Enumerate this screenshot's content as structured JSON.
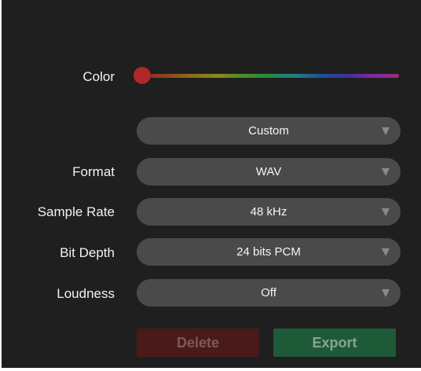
{
  "color": {
    "label": "Color",
    "value_fraction": 0.0
  },
  "preset": {
    "value": "Custom"
  },
  "format": {
    "label": "Format",
    "value": "WAV"
  },
  "sample_rate": {
    "label": "Sample Rate",
    "value": "48 kHz"
  },
  "bit_depth": {
    "label": "Bit Depth",
    "value": "24 bits PCM"
  },
  "loudness": {
    "label": "Loudness",
    "value": "Off"
  },
  "actions": {
    "delete_label": "Delete",
    "export_label": "Export"
  },
  "colors": {
    "panel_background": "#1f1f1f",
    "select_background": "#4a4a4a",
    "knob": "#b0282a",
    "delete_background": "#4a1a1a",
    "export_background": "#1f5a38"
  },
  "icons": {
    "dropdown": "chevron-down-icon"
  }
}
